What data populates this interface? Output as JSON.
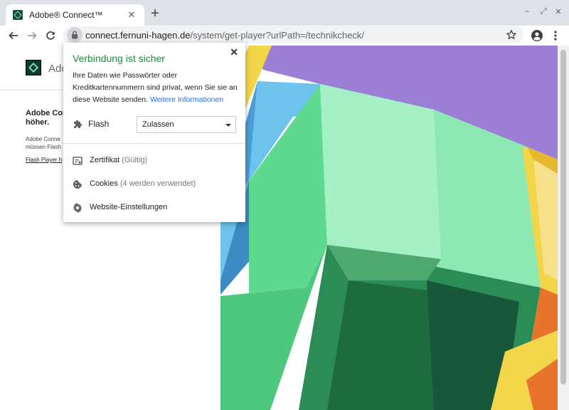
{
  "browser": {
    "tab": {
      "title": "Adobe® Connect™"
    },
    "address": {
      "host": "connect.fernuni-hagen.de",
      "path": "/system/get-player?urlPath=/technikcheck/"
    }
  },
  "page": {
    "brand": "Ado",
    "notice_heading_line1": "Adobe Conn",
    "notice_heading_line2": "höher.",
    "notice_body_line1": "Adobe Conne",
    "notice_body_line2": "müssen Flash",
    "notice_link": "Flash Player h"
  },
  "site_info": {
    "title": "Verbindung ist sicher",
    "description": "Ihre Daten wie Passwörter oder Kreditkartennummern sind privat, wenn Sie sie an diese Website senden.",
    "more_info": "Weitere Informationen",
    "permission": {
      "label": "Flash",
      "value": "Zulassen"
    },
    "certificate": {
      "label": "Zertifikat",
      "status": "(Gültig)"
    },
    "cookies": {
      "label": "Cookies",
      "status": "(4 werden verwendet)"
    },
    "site_settings": {
      "label": "Website-Einstellungen"
    }
  },
  "colors": {
    "secure_title": "#1e8e3e",
    "link": "#1a73e8",
    "art_purple": "#9b7fd4",
    "art_mint": "#8ee8b4",
    "art_green_dark": "#1d6b3e",
    "art_blue": "#6ec3ec",
    "art_yellow": "#f2d548"
  }
}
